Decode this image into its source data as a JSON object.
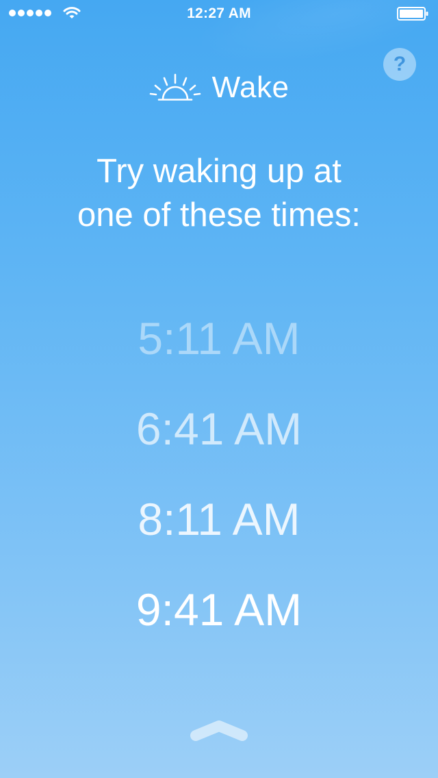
{
  "status_bar": {
    "time": "12:27 AM"
  },
  "header": {
    "title": "Wake",
    "help_label": "?"
  },
  "prompt": {
    "line1": "Try waking up at",
    "line2": "one of these times:"
  },
  "times": [
    "5:11 AM",
    "6:41 AM",
    "8:11 AM",
    "9:41 AM"
  ],
  "colors": {
    "background_top": "#45a8f2",
    "background_bottom": "#9ccff7",
    "help_glyph": "#3f95de"
  },
  "icons": {
    "signal": "signal-dots-icon",
    "wifi": "wifi-icon",
    "battery": "battery-icon",
    "sunrise": "sunrise-icon",
    "chevron": "chevron-up-icon"
  }
}
